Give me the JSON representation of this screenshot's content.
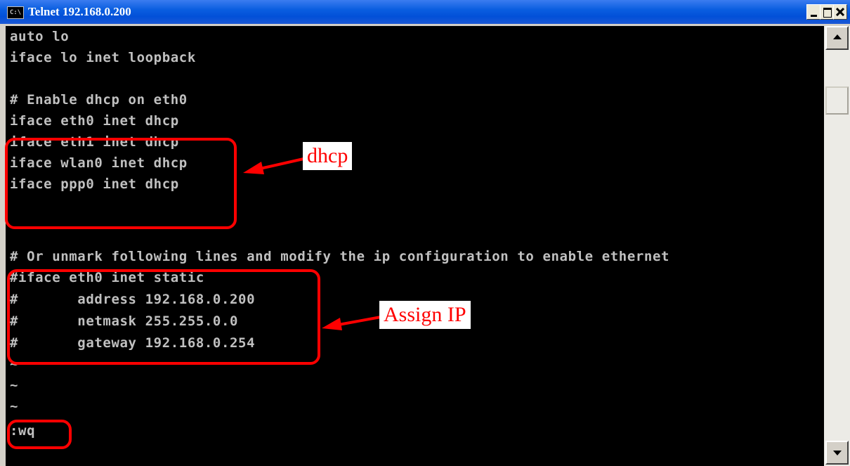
{
  "window": {
    "title": "Telnet 192.168.0.200",
    "icon": "console-icon"
  },
  "console": {
    "lines": [
      "auto lo",
      "iface lo inet loopback",
      "",
      "# Enable dhcp on eth0",
      "iface eth0 inet dhcp",
      "iface eth1 inet dhcp",
      "iface wlan0 inet dhcp",
      "iface ppp0 inet dhcp",
      "",
      "# Or unmark following lines and modify the ip configuration to enable ethernet",
      "#iface eth0 inet static",
      "#       address 192.168.0.200",
      "#       netmask 255.255.0.0",
      "#       gateway 192.168.0.254",
      "~",
      "~",
      "~",
      ":wq"
    ]
  },
  "annotations": {
    "dhcp": "dhcp",
    "assign_ip": "Assign IP"
  },
  "colors": {
    "annotation": "#ff0000",
    "console_bg": "#000000",
    "console_text": "#c0c0c0"
  }
}
